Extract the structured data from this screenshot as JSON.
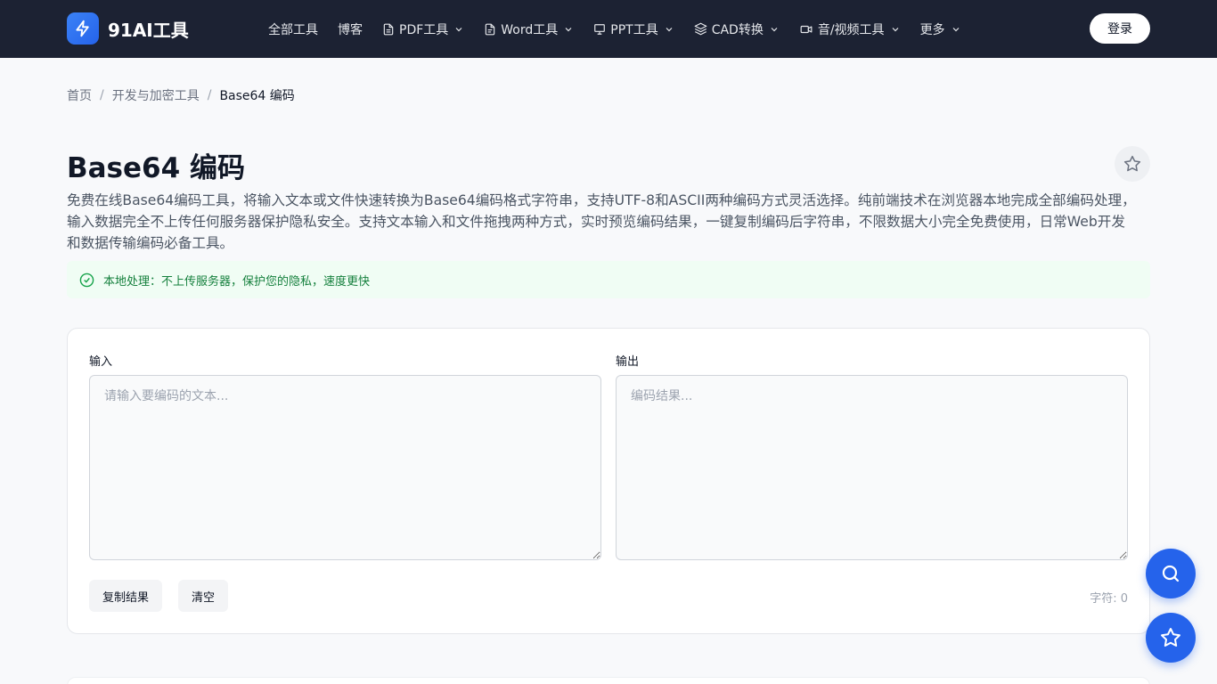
{
  "brand": {
    "name": "91AI工具"
  },
  "nav": {
    "items": [
      {
        "label": "全部工具"
      },
      {
        "label": "博客"
      },
      {
        "label": "PDF工具"
      },
      {
        "label": "Word工具"
      },
      {
        "label": "PPT工具"
      },
      {
        "label": "CAD转换"
      },
      {
        "label": "音/视频工具"
      },
      {
        "label": "更多"
      }
    ],
    "login_label": "登录"
  },
  "breadcrumb": {
    "home": "首页",
    "category": "开发与加密工具",
    "current": "Base64 编码",
    "separator": "/"
  },
  "page": {
    "title": "Base64 编码",
    "description": "免费在线Base64编码工具，将输入文本或文件快速转换为Base64编码格式字符串，支持UTF-8和ASCII两种编码方式灵活选择。纯前端技术在浏览器本地完成全部编码处理，输入数据完全不上传任何服务器保护隐私安全。支持文本输入和文件拖拽两种方式，实时预览编码结果，一键复制编码后字符串，不限数据大小完全免费使用，日常Web开发和数据传输编码必备工具。",
    "notice": "本地处理：不上传服务器，保护您的隐私，速度更快"
  },
  "tool": {
    "input_label": "输入",
    "input_placeholder": "请输入要编码的文本...",
    "input_value": "",
    "output_label": "输出",
    "output_placeholder": "编码结果...",
    "output_value": "",
    "copy_label": "复制结果",
    "clear_label": "清空",
    "char_count": "字符: 0"
  },
  "icons": {
    "logo": "lightning-icon",
    "favorite": "star-icon",
    "notice": "check-circle-icon",
    "fab_search": "search-icon",
    "fab_favorite": "star-icon"
  },
  "colors": {
    "nav_bg": "#1c2233",
    "accent": "#2563eb",
    "success": "#15803d",
    "success_bg": "#f0fdf4"
  }
}
